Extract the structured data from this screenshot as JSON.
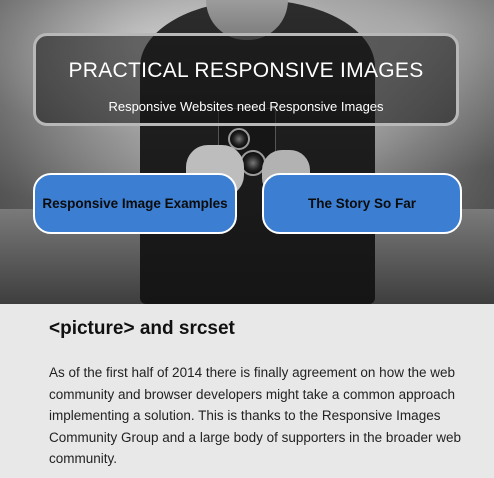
{
  "hero": {
    "title": "PRACTICAL RESPONSIVE IMAGES",
    "subtitle": "Responsive Websites need Responsive Images"
  },
  "nav": {
    "examples_label": "Responsive Image Examples",
    "story_label": "The Story So Far"
  },
  "article": {
    "heading": "<picture> and srcset",
    "body": "As of the first half of 2014 there is finally agreement on how the web community and browser developers might take a common approach implementing a solution. This is thanks to the Responsive Images Community Group and a large body of supporters in the broader web community."
  },
  "colors": {
    "button_blue": "#3c7fd2",
    "content_bg": "#e8e8e8"
  }
}
